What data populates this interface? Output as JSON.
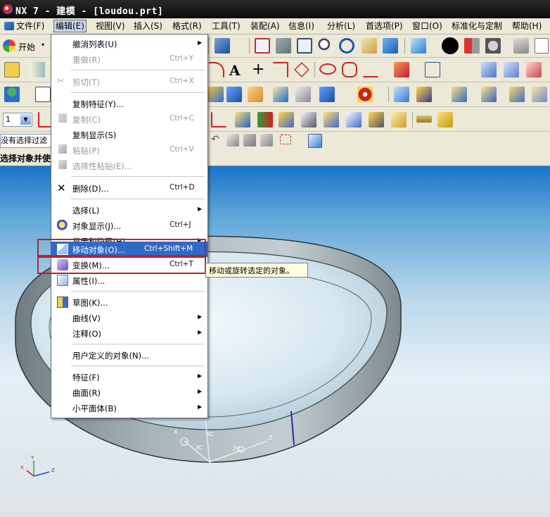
{
  "window": {
    "title": "NX 7 - 建模 - [loudou.prt]"
  },
  "menubar": {
    "items": [
      {
        "label": "文件(F)"
      },
      {
        "label": "编辑(E)"
      },
      {
        "label": "视图(V)"
      },
      {
        "label": "插入(S)"
      },
      {
        "label": "格式(R)"
      },
      {
        "label": "工具(T)"
      },
      {
        "label": "装配(A)"
      },
      {
        "label": "信息(I)"
      },
      {
        "label": "分析(L)"
      },
      {
        "label": "首选项(P)"
      },
      {
        "label": "窗口(O)"
      },
      {
        "label": "标准化与定制"
      },
      {
        "label": "帮助(H)"
      }
    ]
  },
  "toolbar": {
    "start_label": "开始",
    "layer_value": "1",
    "filter_value": "没有选择过滤",
    "status_text": "选择对象并使"
  },
  "edit_menu": {
    "items": [
      {
        "label": "撤消列表(U)",
        "shortcut": "",
        "submenu": true,
        "disabled": false,
        "icon": "none"
      },
      {
        "label": "重做(R)",
        "shortcut": "Ctrl+Y",
        "submenu": false,
        "disabled": true,
        "icon": "none"
      },
      {
        "label": "剪切(T)",
        "shortcut": "Ctrl+X",
        "submenu": false,
        "disabled": true,
        "icon": "scissors-icon"
      },
      {
        "label": "复制特征(Y)...",
        "shortcut": "",
        "submenu": false,
        "disabled": false,
        "icon": "none"
      },
      {
        "label": "复制(C)",
        "shortcut": "Ctrl+C",
        "submenu": false,
        "disabled": true,
        "icon": "copy-icon"
      },
      {
        "label": "复制显示(S)",
        "shortcut": "",
        "submenu": false,
        "disabled": false,
        "icon": "none"
      },
      {
        "label": "粘贴(P)",
        "shortcut": "Ctrl+V",
        "submenu": false,
        "disabled": true,
        "icon": "paste-icon"
      },
      {
        "label": "选择性粘贴(E)...",
        "shortcut": "",
        "submenu": false,
        "disabled": true,
        "icon": "paste-special-icon"
      },
      {
        "label": "删除(D)...",
        "shortcut": "Ctrl+D",
        "submenu": false,
        "disabled": false,
        "icon": "delete-icon"
      },
      {
        "label": "选择(L)",
        "shortcut": "",
        "submenu": true,
        "disabled": false,
        "icon": "none"
      },
      {
        "label": "对象显示(J)...",
        "shortcut": "Ctrl+J",
        "submenu": false,
        "disabled": false,
        "icon": "object-display-icon"
      },
      {
        "label": "显示和隐藏(H)",
        "shortcut": "",
        "submenu": true,
        "disabled": false,
        "icon": "none"
      },
      {
        "label": "移动对象(O)...",
        "shortcut": "Ctrl+Shift+M",
        "submenu": false,
        "disabled": false,
        "icon": "move-object-icon"
      },
      {
        "label": "变换(M)...",
        "shortcut": "Ctrl+T",
        "submenu": false,
        "disabled": false,
        "icon": "transform-icon"
      },
      {
        "label": "属性(I)...",
        "shortcut": "",
        "submenu": false,
        "disabled": false,
        "icon": "properties-icon"
      },
      {
        "label": "草图(K)...",
        "shortcut": "",
        "submenu": false,
        "disabled": false,
        "icon": "sketch-icon"
      },
      {
        "label": "曲线(V)",
        "shortcut": "",
        "submenu": true,
        "disabled": false,
        "icon": "none"
      },
      {
        "label": "注释(O)",
        "shortcut": "",
        "submenu": true,
        "disabled": false,
        "icon": "none"
      },
      {
        "label": "用户定义的对象(N)...",
        "shortcut": "",
        "submenu": false,
        "disabled": false,
        "icon": "none"
      },
      {
        "label": "特征(F)",
        "shortcut": "",
        "submenu": true,
        "disabled": false,
        "icon": "none"
      },
      {
        "label": "曲面(R)",
        "shortcut": "",
        "submenu": true,
        "disabled": false,
        "icon": "none"
      },
      {
        "label": "小平面体(B)",
        "shortcut": "",
        "submenu": true,
        "disabled": false,
        "icon": "none"
      }
    ]
  },
  "tooltip": {
    "text": "移动或旋转选定的对象。"
  },
  "csys": {
    "x": "X",
    "y": "Y",
    "z": "Z",
    "xc": "XC",
    "yc": "YC",
    "zc": "ZC"
  },
  "colors": {
    "highlight": "#316ac5",
    "callout_border": "#b3252b",
    "title_bar": "#111111",
    "menu_bar": "#ece9d8"
  }
}
